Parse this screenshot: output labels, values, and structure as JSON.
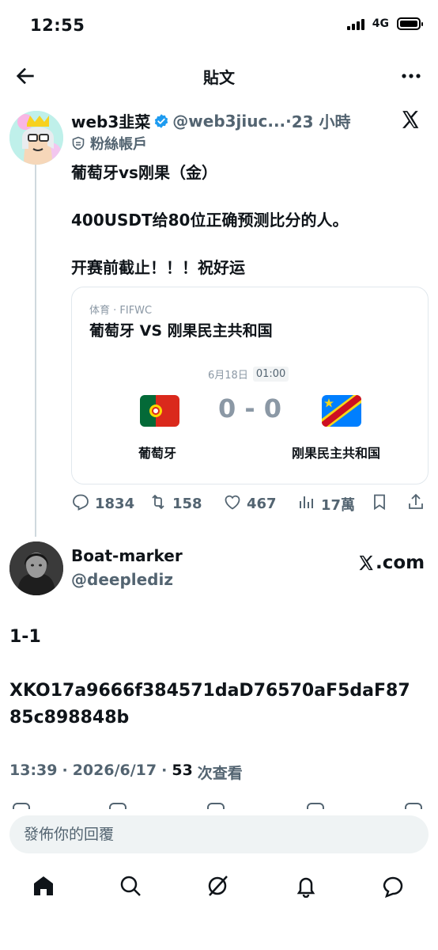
{
  "status_bar": {
    "time": "12:55",
    "network": "4G"
  },
  "header": {
    "title": "貼文"
  },
  "tweet": {
    "author_name": "web3韭菜",
    "handle": "@web3jiuc...",
    "separator": "·",
    "time_ago": "23 小時",
    "fan_label": "粉絲帳戶",
    "text_lines": [
      "葡萄牙vs刚果（金）",
      "400USDT给80位正确预测比分的人。",
      "开赛前截止！！！祝好运"
    ],
    "card": {
      "source": "体育 · FIFWC",
      "title": "葡萄牙 VS 刚果民主共和国",
      "date": "6月18日",
      "time": "01:00",
      "score": "0 - 0",
      "team_home": "葡萄牙",
      "team_away": "刚果民主共和国"
    },
    "stats": {
      "replies": "1834",
      "retweets": "158",
      "likes": "467",
      "views": "17萬"
    }
  },
  "reply": {
    "author_name": "Boat-marker",
    "handle": "@deeplediz",
    "source_label": ".com",
    "text1": "1-1",
    "text2": "XKO17a9666f384571daD76570aF5daF8785c898848b",
    "meta_time": "13:39",
    "meta_date": "2026/6/17",
    "meta_dot": "·",
    "views_num": "53",
    "views_label": "次查看"
  },
  "reply_box": {
    "placeholder": "發佈你的回覆"
  },
  "icons": {
    "back": "arrow-left-icon",
    "more": "more-icon",
    "verified": "verified-badge-icon",
    "fan": "shield-icon",
    "x": "x-logo-icon",
    "reply": "reply-icon",
    "retweet": "retweet-icon",
    "like": "heart-icon",
    "views": "views-icon",
    "bookmark": "bookmark-icon",
    "share": "share-icon",
    "home": "home-icon",
    "search": "search-icon",
    "grok": "grok-icon",
    "notifications": "bell-icon",
    "messages": "message-icon"
  },
  "colors": {
    "accent": "#1d9bf0",
    "text": "#0f1419",
    "muted": "#536471"
  }
}
